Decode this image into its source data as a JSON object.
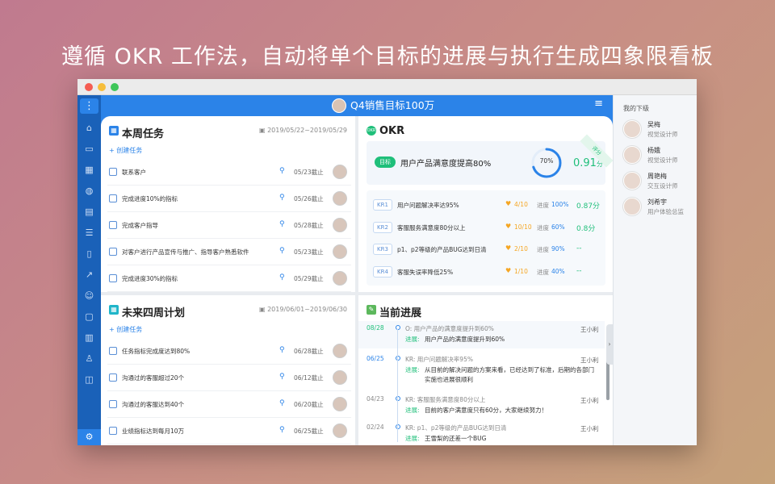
{
  "headline": "遵循 OKR 工作法，自动将单个目标的进展与执行生成四象限看板",
  "header": {
    "goal_title": "Q4销售目标100万",
    "menu_icon": "hamburger-icon"
  },
  "colors": {
    "primary": "#2b83e8",
    "nav": "#1a61b8",
    "green": "#1fbf7a",
    "orange": "#f5a623"
  },
  "weekly": {
    "title": "本周任务",
    "date_range": "2019/05/22~2019/05/29",
    "create": "+ 创建任务",
    "tasks": [
      {
        "name": "联系客户",
        "due": "05/23截止"
      },
      {
        "name": "完成进度10%的指标",
        "due": "05/26截止"
      },
      {
        "name": "完成客户指导",
        "due": "05/28截止"
      },
      {
        "name": "对客户进行产品宣传与推广、指导客户熟悉软件",
        "due": "05/23截止"
      },
      {
        "name": "完成进度30%的指标",
        "due": "05/29截止"
      }
    ]
  },
  "okr": {
    "title": "OKR",
    "objective_tag": "目标",
    "objective": "用户产品满意度提高80%",
    "progress": "70%",
    "progress_value": 0.7,
    "score": "0.91",
    "score_unit": "分",
    "ribbon": "评分",
    "krs": [
      {
        "tag": "KR1",
        "name": "用户问题解决率达95%",
        "confidence": "4/10",
        "progress_label": "进度",
        "progress": "100%",
        "score": "0.87分"
      },
      {
        "tag": "KR2",
        "name": "客服服务满意度80分以上",
        "confidence": "10/10",
        "progress_label": "进度",
        "progress": "60%",
        "score": "0.8分"
      },
      {
        "tag": "KR3",
        "name": "p1、p2等级的产品BUG达到日清",
        "confidence": "2/10",
        "progress_label": "进度",
        "progress": "90%",
        "score": "--"
      },
      {
        "tag": "KR4",
        "name": "客服失误率降低25%",
        "confidence": "1/10",
        "progress_label": "进度",
        "progress": "40%",
        "score": "--"
      }
    ]
  },
  "future": {
    "title": "未来四周计划",
    "date_range": "2019/06/01~2019/06/30",
    "create": "+ 创建任务",
    "tasks": [
      {
        "name": "任务指标完成度达到80%",
        "due": "06/28截止"
      },
      {
        "name": "沟通过的客服超过20个",
        "due": "06/12截止"
      },
      {
        "name": "沟通过的客服达到40个",
        "due": "06/20截止"
      },
      {
        "name": "业绩指标达到每月10万",
        "due": "06/25截止"
      }
    ]
  },
  "progress": {
    "title": "当前进展",
    "entries": [
      {
        "date": "08/28",
        "kr": "O: 用户产品的满意度提升到60%",
        "label": "进展:",
        "text": "用户产品的满意度提升到60%",
        "text2": "",
        "user": "王小利"
      },
      {
        "date": "06/25",
        "kr": "KR: 用户问题解决率95%",
        "label": "进展:",
        "text": "从目前的解决问题的方案来看，已经达到了标准，后期的各部门",
        "text2": "实施也进展很顺利",
        "user": "王小利"
      },
      {
        "date": "04/23",
        "kr": "KR: 客服服务满意度80分以上",
        "label": "进展:",
        "text": "目前的客户满意度只有60分，大家继续努力！",
        "text2": "",
        "user": "王小利"
      },
      {
        "date": "02/24",
        "kr": "KR: p1、p2等级的产品BUG达到日清",
        "label": "进展:",
        "text": "王雪梨的还差一个BUG",
        "text2": "",
        "user": "王小利"
      }
    ]
  },
  "subordinates": {
    "title": "我的下级",
    "people": [
      {
        "name": "吴梅",
        "role": "视觉设计师"
      },
      {
        "name": "杨娥",
        "role": "视觉设计师"
      },
      {
        "name": "周艳梅",
        "role": "交互设计师"
      },
      {
        "name": "刘希宇",
        "role": "用户体验总监"
      }
    ]
  }
}
